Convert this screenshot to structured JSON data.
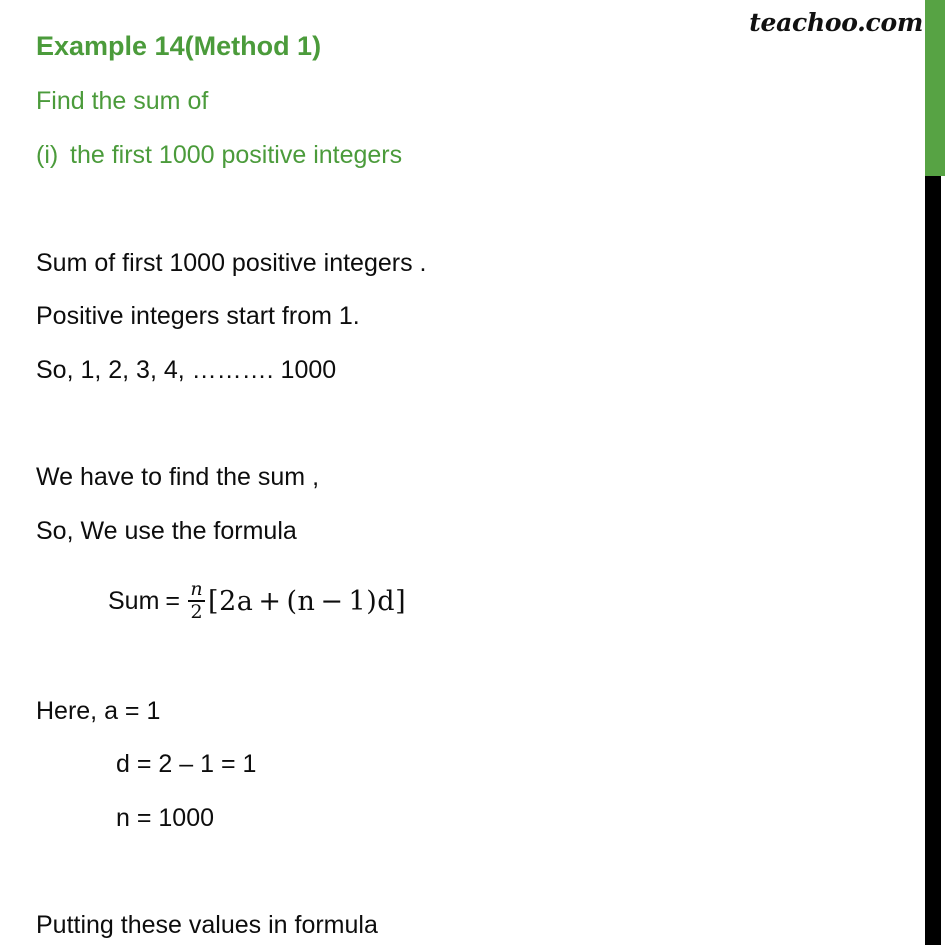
{
  "watermark": {
    "text": "teachoo.com"
  },
  "colors": {
    "heading_green": "#4b9b3b",
    "bar_green": "#57a344",
    "bar_black": "#000000",
    "body_text": "#0d0d0d",
    "background": "#ffffff"
  },
  "heading": {
    "title": "Example 14(Method 1)",
    "subtitle": "Find the sum of",
    "item_marker": "(i)",
    "item_text": "the first 1000 positive integers"
  },
  "body": {
    "line1": "Sum of first 1000 positive integers .",
    "line2": "Positive integers start from 1.",
    "line3": "So, 1, 2, 3, 4, ………. 1000",
    "line4": "We have to find the sum ,",
    "line5": "So, We use the formula",
    "line6": "Here, a = 1",
    "line7": "d = 2 – 1 = 1",
    "line8": "n = 1000",
    "line9": "Putting these values in formula"
  },
  "formula": {
    "label": "Sum",
    "equals": "=",
    "numerator": "n",
    "denominator": "2",
    "open_bracket": "[",
    "term_a": "2a",
    "plus": "+",
    "open_paren": "(",
    "var_n": "n",
    "minus": "−",
    "one": "1",
    "close_paren": ")",
    "var_d": "d",
    "close_bracket": "]"
  }
}
